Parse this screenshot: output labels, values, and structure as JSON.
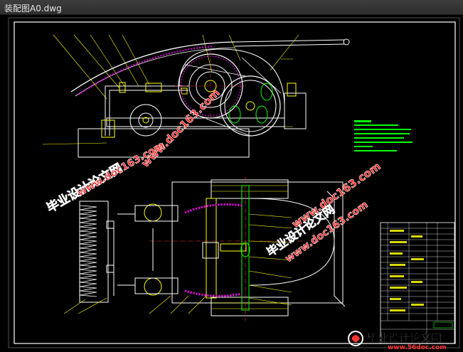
{
  "window": {
    "title": "装配图A0.dwg"
  },
  "colors": {
    "background": "#000000",
    "frame": "#ffffff",
    "geometry": "#ffffff",
    "parts": "#00ff00",
    "leaders": "#ffff00",
    "centerlines": "#ff3333",
    "hatch": "#ff00ff",
    "notes": "#00ff00",
    "watermark": "#ff2222",
    "watermark_outline": "#ffffff"
  },
  "watermarks": {
    "brand_cn": "毕业设计论文网",
    "url": "www.doc163.com",
    "site_url": "www.56doc.com"
  },
  "drawing": {
    "tech_notes_icon": "technical-requirements-text",
    "title_block_icon": "parts-list-table"
  }
}
